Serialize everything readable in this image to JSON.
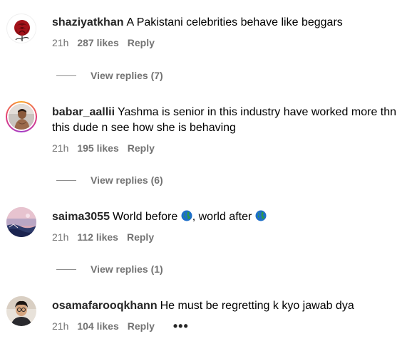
{
  "comments": [
    {
      "username": "shaziyatkhan",
      "text": "A Pakistani celebrities behave like beggars",
      "time": "21h",
      "likes": "287 likes",
      "reply": "Reply",
      "view_replies": "View replies (7)",
      "avatar_icon": "rose-icon"
    },
    {
      "username": "babar_aallii",
      "text": "Yashma is senior in this industry have worked more thn this dude n see how she is behaving",
      "time": "21h",
      "likes": "195 likes",
      "reply": "Reply",
      "view_replies": "View replies (6)",
      "avatar_icon": "person-photo"
    },
    {
      "username": "saima3055",
      "text_before": "World before",
      "text_middle": ", world after",
      "time": "21h",
      "likes": "112 likes",
      "reply": "Reply",
      "view_replies": "View replies (1)",
      "avatar_icon": "landscape-photo"
    },
    {
      "username": "osamafarooqkhann",
      "text": "He must be regretting k kyo jawab dya",
      "time": "21h",
      "likes": "104 likes",
      "reply": "Reply",
      "more": "•••",
      "avatar_icon": "person-photo"
    }
  ],
  "colors": {
    "username": "#262626",
    "meta": "#737373",
    "story_ring_start": "#f9a826",
    "story_ring_mid": "#e33a79"
  }
}
